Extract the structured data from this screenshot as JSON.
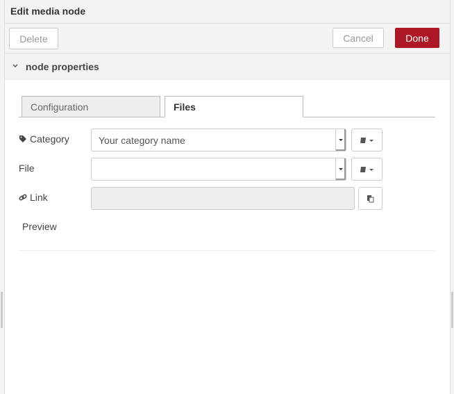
{
  "tray": {
    "title": "Edit media node"
  },
  "toolbar": {
    "delete_label": "Delete",
    "cancel_label": "Cancel",
    "done_label": "Done"
  },
  "section": {
    "title": "node properties"
  },
  "tabs": [
    {
      "label": "Configuration",
      "active": false
    },
    {
      "label": "Files",
      "active": true
    }
  ],
  "form": {
    "category": {
      "label": "Category",
      "value": "Your category name"
    },
    "file": {
      "label": "File",
      "value": ""
    },
    "link": {
      "label": "Link",
      "value": ""
    },
    "preview_label": "Preview"
  },
  "colors": {
    "primary": "#ad1625",
    "panel": "#f3f3f3",
    "border": "#cccccc"
  },
  "icons": {
    "section_toggle": "chevron-down-icon",
    "category": "tag-icon",
    "link": "link-icon",
    "type_menu": "book-icon",
    "copy": "copy-icon"
  }
}
